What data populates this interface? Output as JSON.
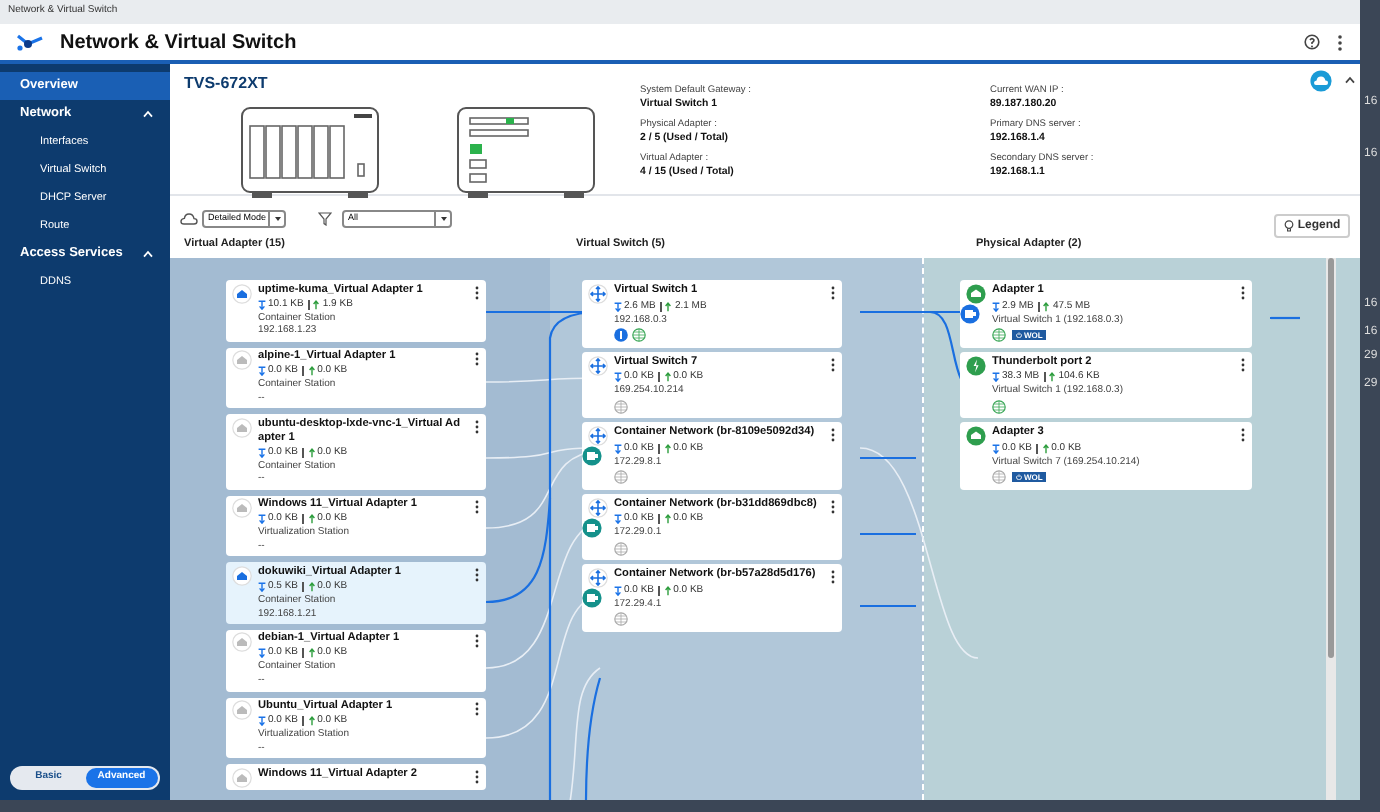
{
  "window": {
    "title": "Network & Virtual Switch"
  },
  "app": {
    "title": "Network & Virtual Switch"
  },
  "sidebar": {
    "items": [
      {
        "label": "Overview",
        "selected": true
      },
      {
        "label": "Network",
        "selected": false,
        "expanded": true,
        "children": [
          {
            "label": "Interfaces",
            "selected": false
          },
          {
            "label": "Virtual Switch",
            "selected": false
          },
          {
            "label": "DHCP Server",
            "selected": false
          },
          {
            "label": "Route",
            "selected": false
          }
        ]
      },
      {
        "label": "Access Services",
        "selected": false,
        "expanded": true,
        "children": [
          {
            "label": "DDNS",
            "selected": false
          }
        ]
      }
    ]
  },
  "mode_toggle": [
    {
      "label": "Basic",
      "selected": false
    },
    {
      "label": "Advanced",
      "selected": true
    }
  ],
  "device": {
    "name": "TVS-672XT"
  },
  "info": [
    [
      {
        "label": "System Default Gateway :",
        "value": "Virtual Switch 1"
      },
      {
        "label": "Physical Adapter :",
        "value": "2 / 5 (Used / Total)"
      },
      {
        "label": "Virtual Adapter :",
        "value": "4 / 15 (Used / Total)"
      }
    ],
    [
      {
        "label": "Current WAN IP :",
        "value": "89.187.180.20"
      },
      {
        "label": "Primary DNS server :",
        "value": "192.168.1.4"
      },
      {
        "label": "Secondary DNS server :",
        "value": "192.168.1.1"
      }
    ]
  ],
  "toolbar": {
    "view_select": "Detailed Mode",
    "filter_select": "All",
    "legend_button": "Legend"
  },
  "column_headings": [
    "Virtual Adapter (15)",
    "Virtual Switch (5)",
    "Physical Adapter (2)"
  ],
  "virtual_adapters": [
    {
      "name": "uptime-kuma_Virtual Adapter 1",
      "tx": "10.1 KB",
      "rx": "1.9 KB",
      "source": "Container Station",
      "ip": "192.168.1.23",
      "active": true,
      "selected": false
    },
    {
      "name": "alpine-1_Virtual Adapter 1",
      "tx": "0.0 KB",
      "rx": "0.0 KB",
      "source": "Container Station",
      "ip": "--",
      "active": false,
      "selected": false
    },
    {
      "name": "ubuntu-desktop-lxde-vnc-1_Virtual Adapter 1",
      "tx": "0.0 KB",
      "rx": "0.0 KB",
      "source": "Container Station",
      "ip": "--",
      "active": false,
      "selected": false
    },
    {
      "name": "Windows 11_Virtual Adapter 1",
      "tx": "0.0 KB",
      "rx": "0.0 KB",
      "source": "Virtualization Station",
      "ip": "--",
      "active": false,
      "selected": false
    },
    {
      "name": "dokuwiki_Virtual Adapter 1",
      "tx": "0.5 KB",
      "rx": "0.0 KB",
      "source": "Container Station",
      "ip": "192.168.1.21",
      "active": true,
      "selected": true
    },
    {
      "name": "debian-1_Virtual Adapter 1",
      "tx": "0.0 KB",
      "rx": "0.0 KB",
      "source": "Container Station",
      "ip": "--",
      "active": false,
      "selected": false
    },
    {
      "name": "Ubuntu_Virtual Adapter 1",
      "tx": "0.0 KB",
      "rx": "0.0 KB",
      "source": "Virtualization Station",
      "ip": "--",
      "active": false,
      "selected": false
    },
    {
      "name": "Windows 11_Virtual Adapter 2",
      "selected": false
    }
  ],
  "virtual_switches": [
    {
      "name": "Virtual Switch 1",
      "tx": "2.6 MB",
      "rx": "2.1 MB",
      "ip": "192.168.0.3",
      "default_gateway": true,
      "internet": true,
      "port": false
    },
    {
      "name": "Virtual Switch 7",
      "tx": "0.0 KB",
      "rx": "0.0 KB",
      "ip": "169.254.10.214",
      "default_gateway": false,
      "internet": false,
      "port": false
    },
    {
      "name": "Container Network (br-8109e5092d34)",
      "tx": "0.0 KB",
      "rx": "0.0 KB",
      "ip": "172.29.8.1",
      "default_gateway": false,
      "internet": false,
      "port": true
    },
    {
      "name": "Container Network (br-b31dd869dbc8)",
      "tx": "0.0 KB",
      "rx": "0.0 KB",
      "ip": "172.29.0.1",
      "default_gateway": false,
      "internet": false,
      "port": true
    },
    {
      "name": "Container Network (br-b57a28d5d176)",
      "tx": "0.0 KB",
      "rx": "0.0 KB",
      "ip": "172.29.4.1",
      "default_gateway": false,
      "internet": false,
      "port": true
    }
  ],
  "physical_adapters": [
    {
      "kind": "ethernet",
      "name": "Adapter 1",
      "tx": "2.9 MB",
      "rx": "47.5 MB",
      "switch": "Virtual Switch 1 (192.168.0.3)",
      "internet": true,
      "wol_badge": "WOL",
      "port": true
    },
    {
      "kind": "thunderbolt",
      "name": "Thunderbolt port 2",
      "tx": "38.3 MB",
      "rx": "104.6 KB",
      "switch": "Virtual Switch 1 (192.168.0.3)",
      "internet": true,
      "port": false
    },
    {
      "kind": "ethernet",
      "name": "Adapter 3",
      "tx": "0.0 KB",
      "rx": "0.0 KB",
      "switch": "Virtual Switch 7 (169.254.10.214)",
      "internet": false,
      "wol_badge": "WOL",
      "port": false
    }
  ],
  "background_fragments": [
    "16",
    "16",
    "16",
    "16",
    "29",
    "29"
  ]
}
